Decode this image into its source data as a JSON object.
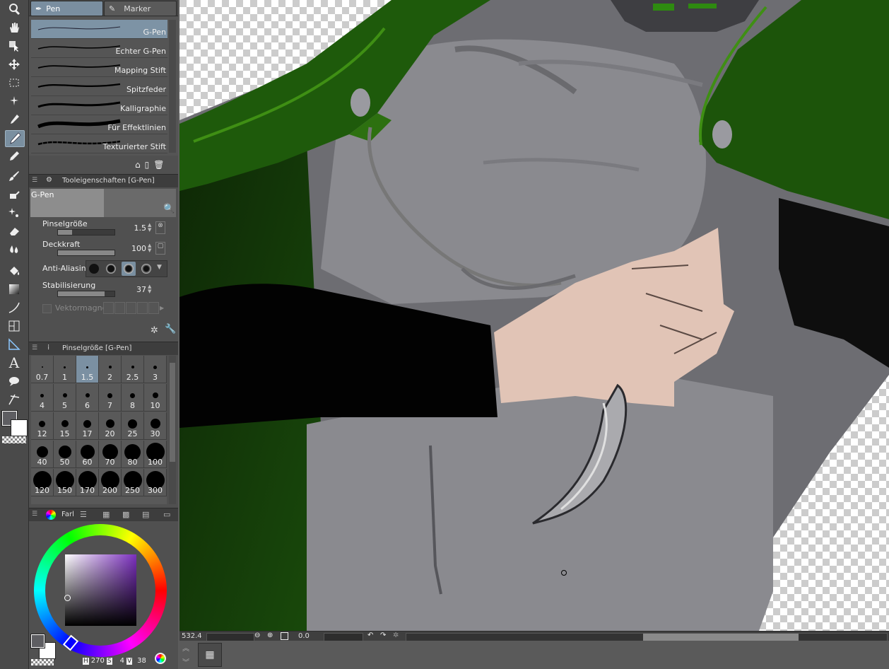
{
  "tool_tabs": {
    "pen": "Pen",
    "marker": "Marker"
  },
  "brushes": [
    {
      "label": "G-Pen",
      "active": true
    },
    {
      "label": "Echter G-Pen",
      "active": false
    },
    {
      "label": "Mapping Stift",
      "active": false
    },
    {
      "label": "Spitzfeder",
      "active": false
    },
    {
      "label": "Kalligraphie",
      "active": false
    },
    {
      "label": "Für Effektlinien",
      "active": false
    },
    {
      "label": "Texturierter Stift",
      "active": false
    }
  ],
  "tool_properties": {
    "header": "Tooleigenschaften [G-Pen]",
    "preset_name": "G-Pen",
    "brush_size": {
      "label": "Pinselgröße",
      "value": "1.5",
      "level": 0.25
    },
    "opacity": {
      "label": "Deckkraft",
      "value": "100",
      "level": 1.0
    },
    "anti_aliasing": {
      "label": "Anti-Aliasing"
    },
    "stabilization": {
      "label": "Stabilisierung",
      "value": "37",
      "level": 0.82
    },
    "vector_magnet": {
      "label": "Vektormagnet"
    }
  },
  "brush_size_panel": {
    "header": "Pinselgröße [G-Pen]",
    "sizes": [
      "0.7",
      "1",
      "1.5",
      "2",
      "2.5",
      "3",
      "4",
      "5",
      "6",
      "7",
      "8",
      "10",
      "12",
      "15",
      "17",
      "20",
      "25",
      "30",
      "40",
      "50",
      "60",
      "70",
      "80",
      "100",
      "120",
      "150",
      "170",
      "200",
      "250",
      "300"
    ],
    "active": "1.5"
  },
  "color_panel": {
    "tab_label": "Farl",
    "h_label": "H",
    "h_value": "270",
    "s_label": "S",
    "s_value": "4",
    "v_label": "V",
    "v_value": "38"
  },
  "status": {
    "zoom": "532.4",
    "rotation": "0.0"
  },
  "colors": {
    "accent": "#7a8fa0",
    "main_color": "#5e5e62",
    "hood_green": "#1f5c0a"
  }
}
